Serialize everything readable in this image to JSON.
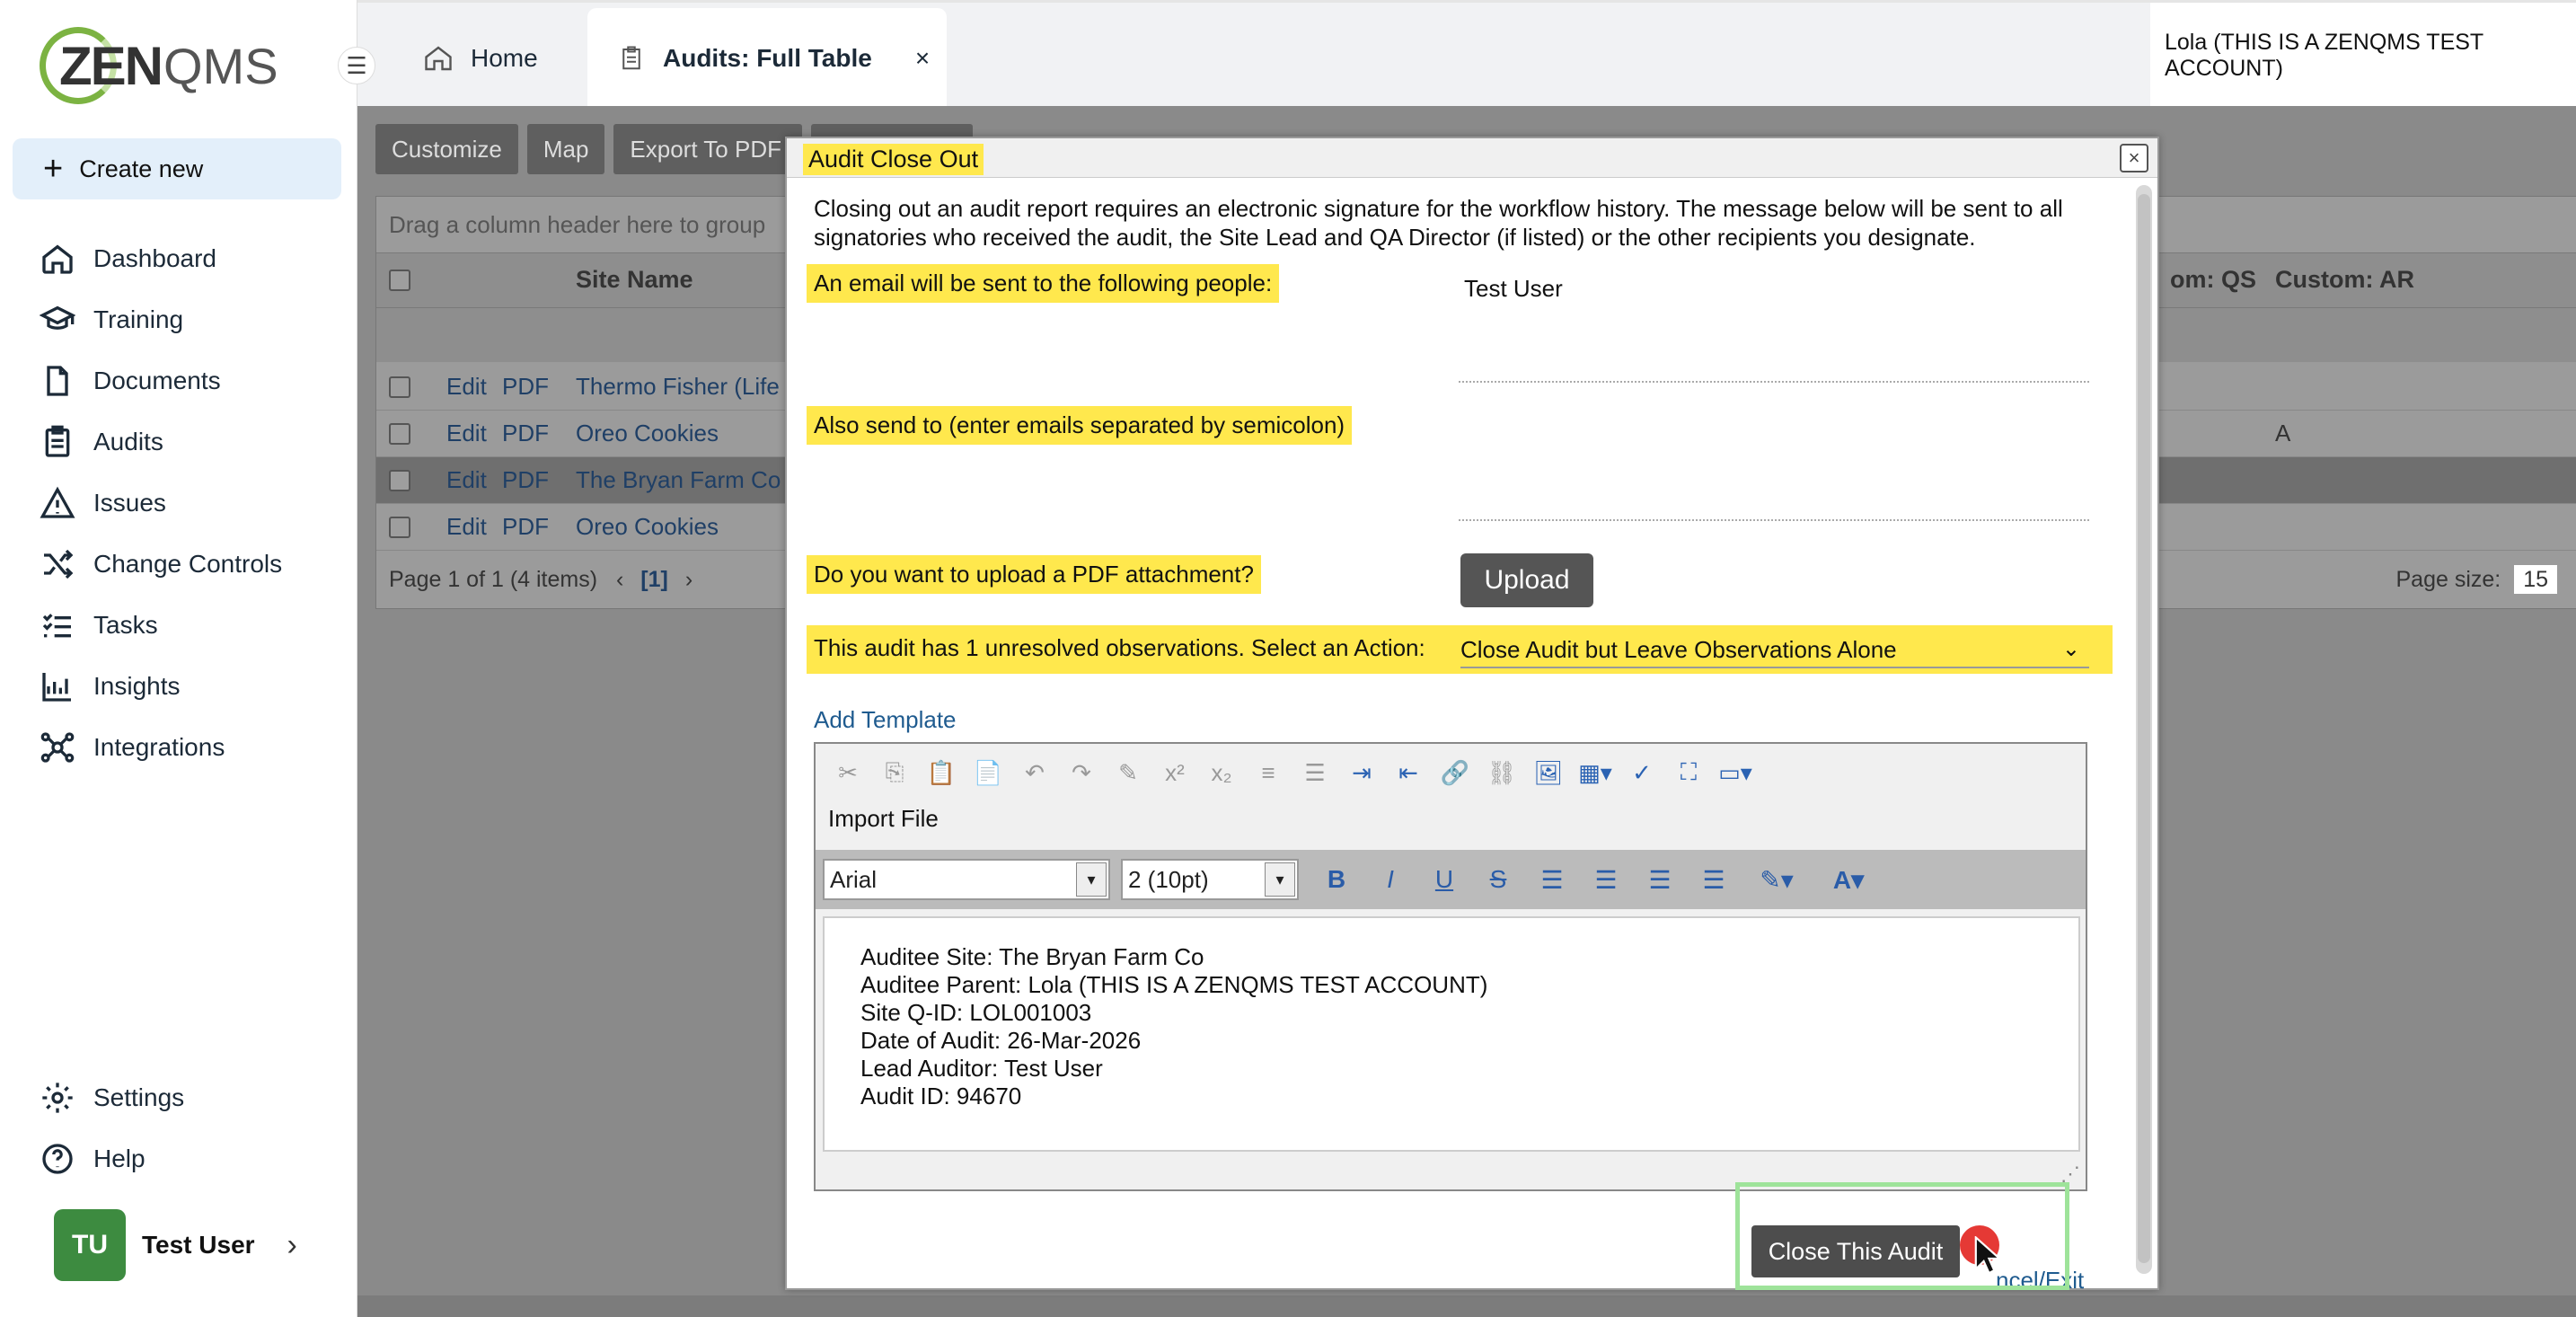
{
  "logo": {
    "text_zen": "ZEN",
    "text_qms": "QMS"
  },
  "sidebar": {
    "create_new": "Create new",
    "items": [
      {
        "label": "Dashboard",
        "icon": "home-icon"
      },
      {
        "label": "Training",
        "icon": "graduation-cap-icon"
      },
      {
        "label": "Documents",
        "icon": "document-icon"
      },
      {
        "label": "Audits",
        "icon": "clipboard-icon"
      },
      {
        "label": "Issues",
        "icon": "warning-icon"
      },
      {
        "label": "Change Controls",
        "icon": "shuffle-icon"
      },
      {
        "label": "Tasks",
        "icon": "checklist-icon"
      },
      {
        "label": "Insights",
        "icon": "chart-icon"
      },
      {
        "label": "Integrations",
        "icon": "network-icon"
      }
    ],
    "bottom": [
      {
        "label": "Settings",
        "icon": "gear-icon"
      },
      {
        "label": "Help",
        "icon": "help-icon"
      }
    ],
    "user": {
      "initials": "TU",
      "name": "Test User"
    }
  },
  "tabs": {
    "home": "Home",
    "audits": "Audits: Full Table",
    "close": "×"
  },
  "account": "Lola (THIS IS A ZENQMS TEST ACCOUNT)",
  "toolbar": {
    "customize": "Customize",
    "map": "Map",
    "export_pdf": "Export To PDF"
  },
  "grid": {
    "group_hint": "Drag a column header here to group",
    "headers": {
      "site_name": "Site Name",
      "custom_qs": "om: QS",
      "custom_ar": "Custom: AR"
    },
    "rows": [
      {
        "edit": "Edit",
        "pdf": "PDF",
        "site": "Thermo Fisher (Life",
        "ar": ""
      },
      {
        "edit": "Edit",
        "pdf": "PDF",
        "site": "Oreo Cookies",
        "ar": "A"
      },
      {
        "edit": "Edit",
        "pdf": "PDF",
        "site": "The Bryan Farm Co",
        "ar": ""
      },
      {
        "edit": "Edit",
        "pdf": "PDF",
        "site": "Oreo Cookies",
        "ar": ""
      }
    ],
    "pager": "Page 1 of 1 (4 items)",
    "current_page": "[1]",
    "page_size_label": "Page size:",
    "page_size": "15"
  },
  "modal": {
    "title": "Audit Close Out",
    "close": "×",
    "intro": "Closing out an audit report requires an electronic signature for the workflow history. The message below will be sent to all signatories who received the audit, the Site Lead and QA Director (if listed) or the other recipients you designate.",
    "email_label": "An email will be sent to the following people:",
    "email_value": "Test User",
    "also_send_label": "Also send to (enter emails separated by semicolon)",
    "also_send_value": "",
    "pdf_label": "Do you want to upload a PDF attachment?",
    "upload": "Upload",
    "action_label": "This audit has 1 unresolved observations. Select an Action:",
    "action_value": "Close Audit but Leave Observations Alone",
    "add_template": "Add Template",
    "import_file": "Import File",
    "font": "Arial",
    "size": "2 (10pt)",
    "body_lines": [
      "Auditee Site: The Bryan Farm Co",
      "Auditee Parent: Lola (THIS IS A ZENQMS TEST ACCOUNT)",
      "Site Q-ID: LOL001003",
      "Date of Audit: 26-Mar-2026",
      "Lead Auditor: Test User",
      "Audit ID: 94670"
    ],
    "close_btn": "Close This Audit",
    "cancel": "ncel/Exit"
  },
  "colors": {
    "highlight": "#ffe84d",
    "brand_green": "#3d8b40",
    "link": "#1f5b8f"
  }
}
